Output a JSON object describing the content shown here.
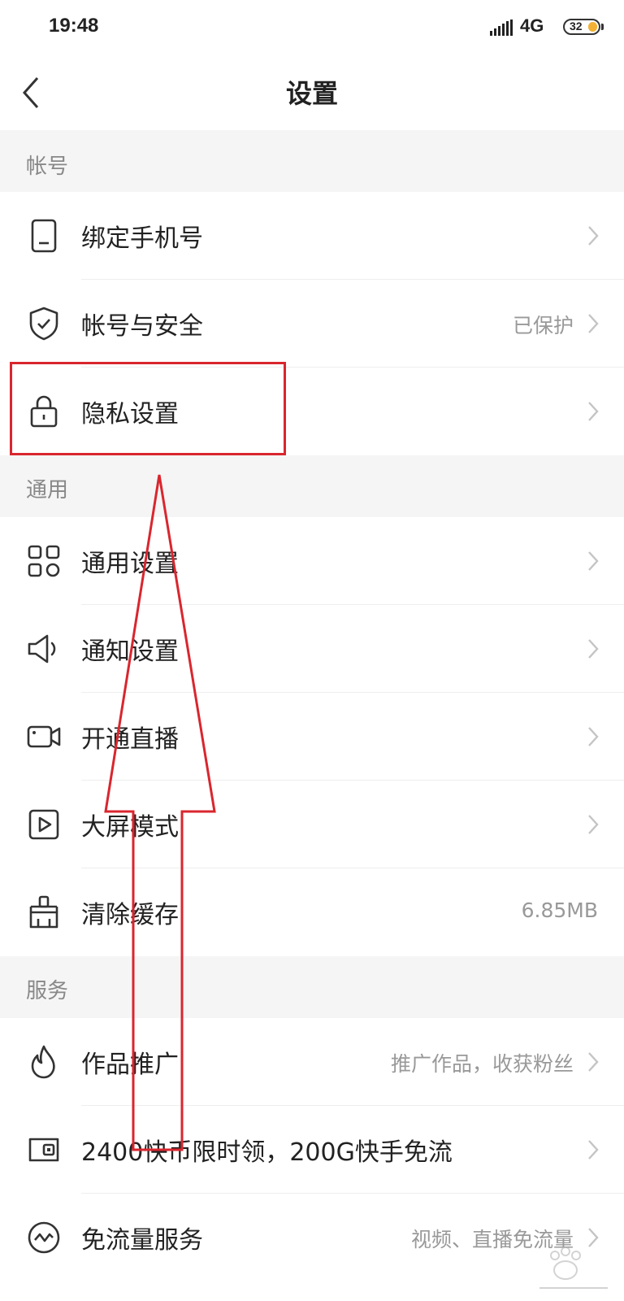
{
  "status_bar": {
    "time": "19:48",
    "network": "4G",
    "battery": "32"
  },
  "header": {
    "title": "设置"
  },
  "sections": {
    "account": {
      "title": "帐号",
      "items": {
        "bind_phone": {
          "label": "绑定手机号",
          "value": ""
        },
        "account_security": {
          "label": "帐号与安全",
          "value": "已保护"
        },
        "privacy": {
          "label": "隐私设置",
          "value": ""
        }
      }
    },
    "general": {
      "title": "通用",
      "items": {
        "general_settings": {
          "label": "通用设置",
          "value": ""
        },
        "notification_settings": {
          "label": "通知设置",
          "value": ""
        },
        "live_stream": {
          "label": "开通直播",
          "value": ""
        },
        "large_screen": {
          "label": "大屏模式",
          "value": ""
        },
        "clear_cache": {
          "label": "清除缓存",
          "value": "6.85MB"
        }
      }
    },
    "service": {
      "title": "服务",
      "items": {
        "promotion": {
          "label": "作品推广",
          "value": "推广作品，收获粉丝"
        },
        "coin_offer": {
          "label": "2400快币限时领，200G快手免流",
          "value": ""
        },
        "free_data": {
          "label": "免流量服务",
          "value": "视频、直播免流量"
        }
      }
    }
  },
  "colors": {
    "accent_annotation": "#d9262e",
    "section_bg": "#f5f5f5",
    "secondary_text": "#999999"
  },
  "icons": {
    "back": "chevron-left-icon",
    "phone": "phone-icon",
    "shield": "shield-check-icon",
    "lock": "lock-icon",
    "grid": "grid-icon",
    "speaker": "speaker-icon",
    "camera": "video-camera-icon",
    "play": "play-screen-icon",
    "broom": "broom-icon",
    "flame": "flame-icon",
    "wallet": "wallet-icon",
    "free": "free-data-icon"
  }
}
